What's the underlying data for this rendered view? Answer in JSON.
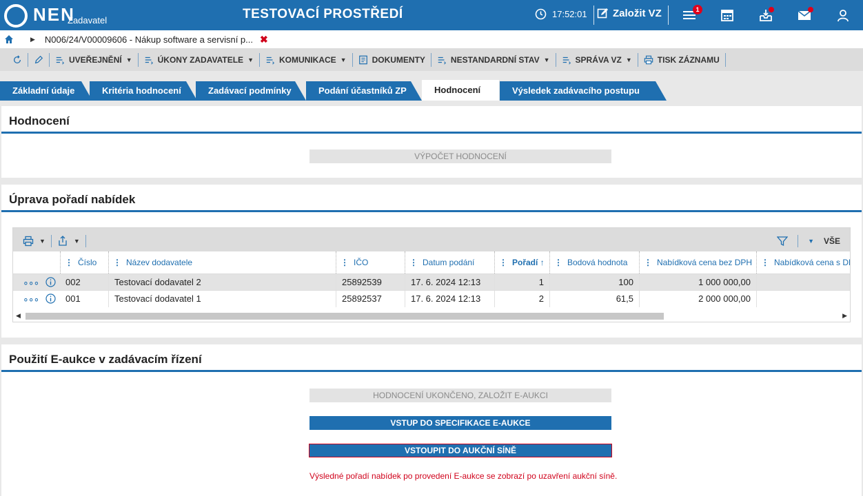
{
  "header": {
    "logo_text": "NEN",
    "logo_sub": "Zadavatel",
    "env_title": "TESTOVACÍ PROSTŘEDÍ",
    "time": "17:52:01",
    "create_label": "Založit VZ",
    "menu_badge": "1"
  },
  "breadcrumb": {
    "path": "N006/24/V00009606 - Nákup software a servisní p...",
    "close": "✖"
  },
  "toolbar": {
    "items": [
      {
        "label": "UVEŘEJNĚNÍ"
      },
      {
        "label": "ÚKONY ZADAVATELE"
      },
      {
        "label": "KOMUNIKACE"
      },
      {
        "label": "DOKUMENTY"
      },
      {
        "label": "NESTANDARDNÍ STAV"
      },
      {
        "label": "SPRÁVA VZ"
      },
      {
        "label": "TISK ZÁZNAMU"
      }
    ]
  },
  "tabs": [
    {
      "label": "Základní údaje"
    },
    {
      "label": "Kritéria hodnocení"
    },
    {
      "label": "Zadávací podmínky"
    },
    {
      "label": "Podání účastníků ZP"
    },
    {
      "label": "Hodnocení"
    },
    {
      "label": "Výsledek zadávacího postupu"
    }
  ],
  "panel1": {
    "title": "Hodnocení",
    "calc_button": "VÝPOČET HODNOCENÍ"
  },
  "panel2": {
    "title": "Úprava pořadí nabídek",
    "filter_all": "VŠE",
    "columns": [
      {
        "label": "Číslo"
      },
      {
        "label": "Název dodavatele"
      },
      {
        "label": "IČO"
      },
      {
        "label": "Datum podání"
      },
      {
        "label": "Pořadí"
      },
      {
        "label": "Bodová hodnota"
      },
      {
        "label": "Nabídková cena bez DPH"
      },
      {
        "label": "Nabídková cena s DPH"
      }
    ],
    "sort_arrow": "↑",
    "rows": [
      {
        "cislo": "002",
        "nazev": "Testovací dodavatel 2",
        "ico": "25892539",
        "datum": "17. 6. 2024 12:13",
        "poradi": "1",
        "body": "100",
        "cena_bez": "1 000 000,00",
        "cena_s": ""
      },
      {
        "cislo": "001",
        "nazev": "Testovací dodavatel 1",
        "ico": "25892537",
        "datum": "17. 6. 2024 12:13",
        "poradi": "2",
        "body": "61,5",
        "cena_bez": "2 000 000,00",
        "cena_s": ""
      }
    ]
  },
  "panel3": {
    "title": "Použití E-aukce v zadávacím řízení",
    "btn_finish": "HODNOCENÍ UKONČENO, ZALOŽIT E-AUKCI",
    "btn_spec": "VSTUP DO SPECIFIKACE E-AUKCE",
    "btn_hall": "VSTOUPIT DO AUKČNÍ SÍNĚ",
    "note": "Výsledné pořadí nabídek po provedení E-aukce se zobrazí po uzavření aukční síně."
  },
  "colors": {
    "brand": "#1f6fb0",
    "alert": "#d0021b",
    "badge": "#e0001b"
  }
}
